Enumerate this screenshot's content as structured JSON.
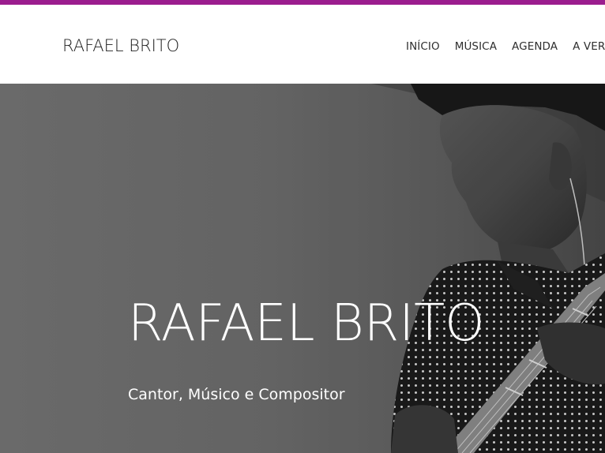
{
  "colors": {
    "accent_bar": "#9b1d8e",
    "header_bg": "#ffffff",
    "text_dark": "#1d1d1d",
    "hero_text": "#ffffff"
  },
  "header": {
    "site_title": "RAFAEL BRITO",
    "nav": [
      {
        "label": "INÍCIO"
      },
      {
        "label": "MÚSICA"
      },
      {
        "label": "AGENDA"
      },
      {
        "label": "A VER"
      }
    ]
  },
  "hero": {
    "title": "RAFAEL BRITO",
    "subtitle": "Cantor, Músico e Compositor",
    "image": "grayscale-photo-man-playing-guitar"
  }
}
